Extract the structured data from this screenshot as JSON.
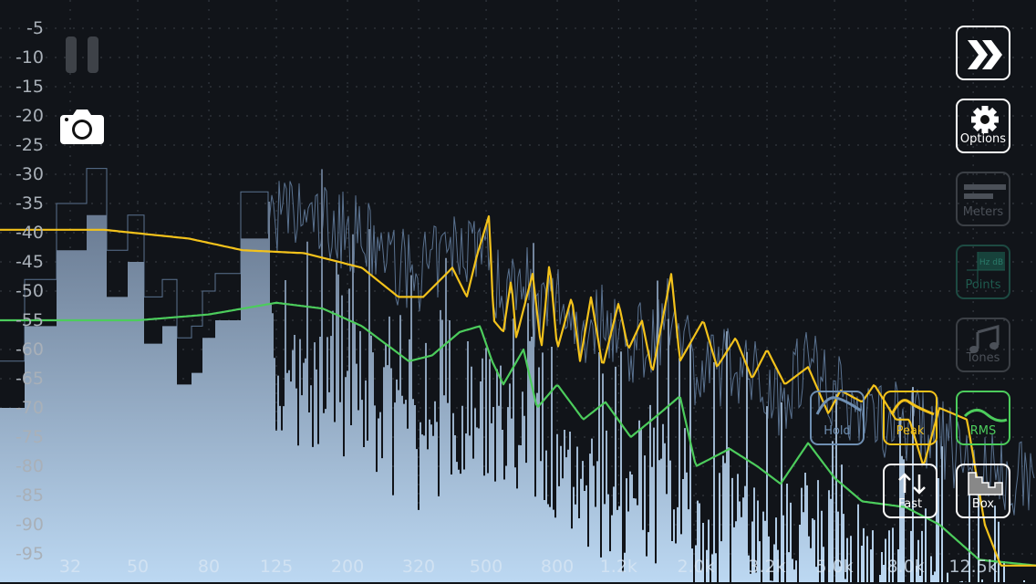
{
  "y_axis": {
    "unit": "dB",
    "labels": [
      "-5",
      "-10",
      "-15",
      "-20",
      "-25",
      "-30",
      "-35",
      "-40",
      "-45",
      "-50",
      "-55",
      "-60",
      "-65",
      "-70",
      "-75",
      "-80",
      "-85",
      "-90",
      "-95"
    ]
  },
  "x_axis": {
    "unit": "Hz",
    "labels": [
      {
        "t": "32",
        "f": 32
      },
      {
        "t": "50",
        "f": 50
      },
      {
        "t": "80",
        "f": 80
      },
      {
        "t": "125",
        "f": 125
      },
      {
        "t": "200",
        "f": 200
      },
      {
        "t": "320",
        "f": 320
      },
      {
        "t": "500",
        "f": 500
      },
      {
        "t": "800",
        "f": 800
      },
      {
        "t": "1.2k",
        "f": 1200
      },
      {
        "t": "2.0k",
        "f": 2000
      },
      {
        "t": "3.2k",
        "f": 3200
      },
      {
        "t": "5.0k",
        "f": 5000
      },
      {
        "t": "8.0k",
        "f": 8000
      },
      {
        "t": "12.5k",
        "f": 12500
      }
    ]
  },
  "controls": {
    "forward": "fast-forward",
    "options": "Options",
    "meters": "Meters",
    "points": "Points",
    "tones": "Tones",
    "hold": "Hold",
    "peak": "Peak",
    "rms": "RMS",
    "fast": "Fast",
    "box": "Box",
    "points_icon_text": "Hz dB"
  },
  "colors": {
    "peak": "#f3c21b",
    "rms": "#4ccc5c",
    "hold": "#6f8fb2",
    "bg": "#111419"
  },
  "peak_curve": [
    [
      20,
      -39.5
    ],
    [
      40,
      -39.5
    ],
    [
      70,
      -41
    ],
    [
      100,
      -43
    ],
    [
      150,
      -43.5
    ],
    [
      220,
      -46
    ],
    [
      280,
      -51
    ],
    [
      330,
      -51
    ],
    [
      400,
      -46
    ],
    [
      440,
      -51
    ],
    [
      470,
      -44
    ],
    [
      510,
      -37
    ],
    [
      525,
      -55
    ],
    [
      560,
      -57
    ],
    [
      590,
      -48
    ],
    [
      610,
      -58
    ],
    [
      680,
      -47
    ],
    [
      720,
      -60
    ],
    [
      760,
      -45
    ],
    [
      800,
      -60
    ],
    [
      880,
      -51
    ],
    [
      930,
      -62
    ],
    [
      1000,
      -51
    ],
    [
      1080,
      -63
    ],
    [
      1200,
      -52
    ],
    [
      1280,
      -60
    ],
    [
      1400,
      -55
    ],
    [
      1500,
      -64
    ],
    [
      1700,
      -47
    ],
    [
      1800,
      -62
    ],
    [
      2100,
      -55
    ],
    [
      2300,
      -63
    ],
    [
      2600,
      -58
    ],
    [
      2900,
      -65
    ],
    [
      3200,
      -60
    ],
    [
      3600,
      -66
    ],
    [
      4200,
      -63
    ],
    [
      4800,
      -71
    ],
    [
      5200,
      -67
    ],
    [
      6000,
      -69
    ],
    [
      6500,
      -66
    ],
    [
      7500,
      -72
    ],
    [
      8200,
      -72
    ],
    [
      9000,
      -80
    ],
    [
      10000,
      -70
    ],
    [
      12000,
      -72
    ],
    [
      13500,
      -90
    ],
    [
      15000,
      -97
    ],
    [
      19000,
      -97
    ]
  ],
  "rms_curve": [
    [
      20,
      -55
    ],
    [
      50,
      -55
    ],
    [
      80,
      -54
    ],
    [
      125,
      -52
    ],
    [
      170,
      -53
    ],
    [
      220,
      -56
    ],
    [
      300,
      -62
    ],
    [
      350,
      -61
    ],
    [
      420,
      -57
    ],
    [
      480,
      -56
    ],
    [
      520,
      -62
    ],
    [
      560,
      -66
    ],
    [
      640,
      -60
    ],
    [
      700,
      -70
    ],
    [
      800,
      -66
    ],
    [
      950,
      -72
    ],
    [
      1100,
      -69
    ],
    [
      1300,
      -75
    ],
    [
      1500,
      -72
    ],
    [
      1800,
      -68
    ],
    [
      2000,
      -80
    ],
    [
      2500,
      -77
    ],
    [
      3000,
      -80
    ],
    [
      3500,
      -83
    ],
    [
      4200,
      -76
    ],
    [
      5000,
      -82
    ],
    [
      6000,
      -86
    ],
    [
      8000,
      -87
    ],
    [
      10000,
      -90
    ],
    [
      13000,
      -96
    ],
    [
      19000,
      -97
    ]
  ]
}
